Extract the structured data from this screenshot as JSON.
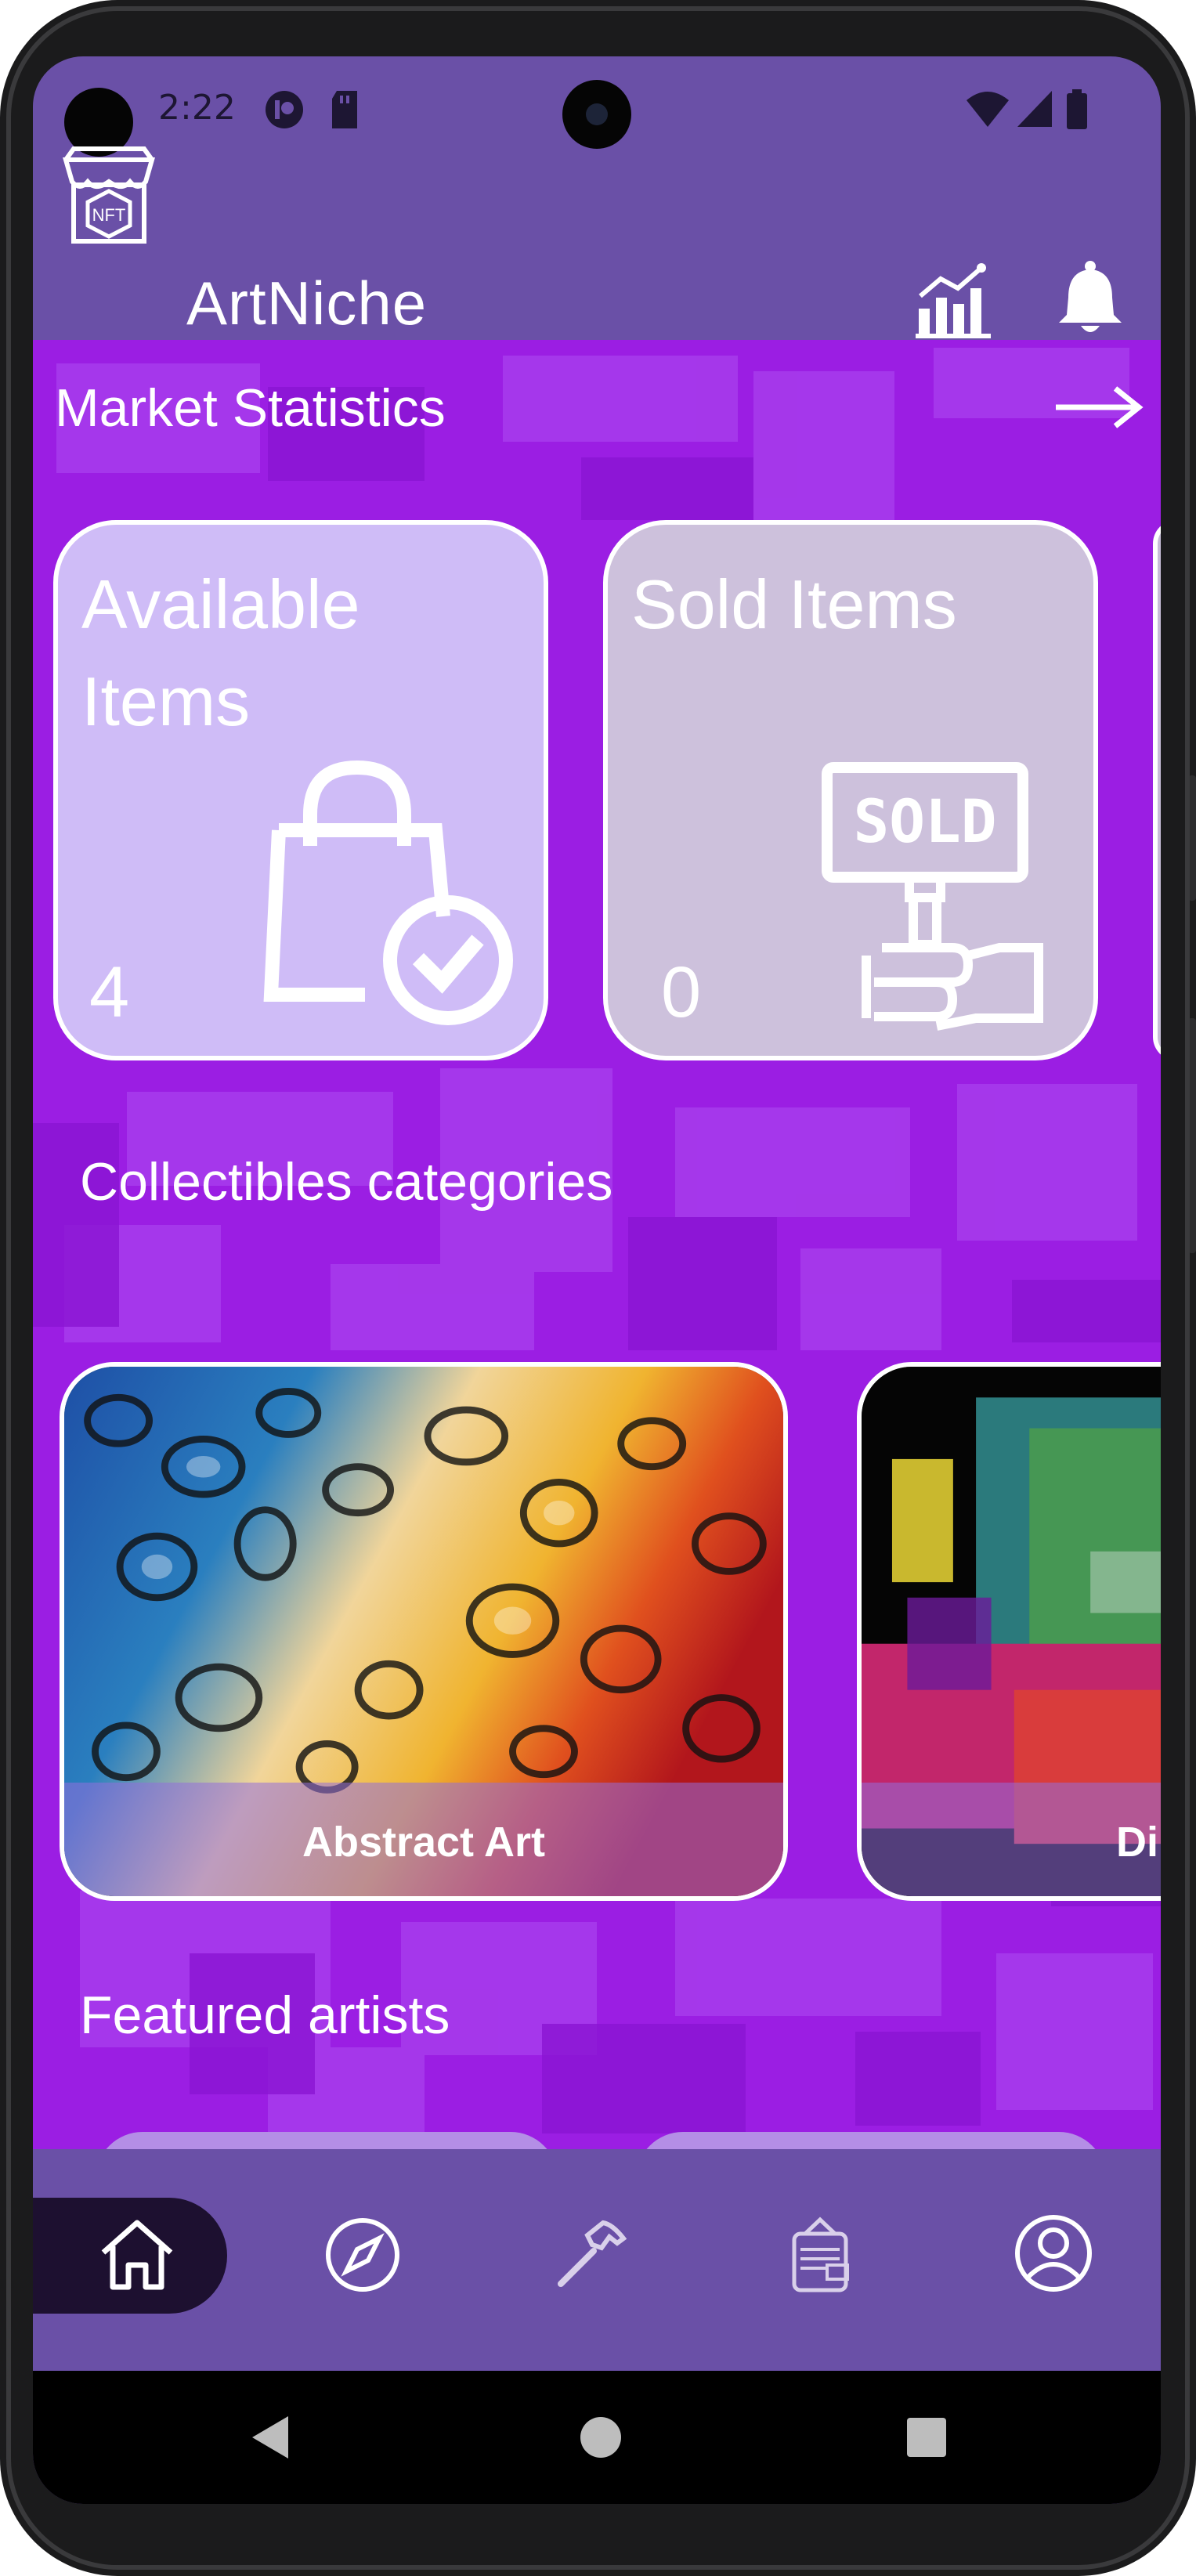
{
  "status_bar": {
    "time": "2:22"
  },
  "app": {
    "title": "ArtNiche",
    "logo_text": "NFT"
  },
  "market": {
    "section_title": "Market Statistics",
    "cards": [
      {
        "label": "Available Items",
        "count": "4"
      },
      {
        "label": "Sold Items",
        "count": "0",
        "sign_text": "SOLD"
      }
    ]
  },
  "categories": {
    "section_title": "Collectibles categories",
    "items": [
      {
        "label": "Abstract Art"
      },
      {
        "label": "Di"
      }
    ]
  },
  "artists": {
    "section_title": "Featured artists"
  },
  "bottom_nav": {
    "items": [
      {
        "icon": "home-icon",
        "active": true
      },
      {
        "icon": "compass-icon",
        "active": false
      },
      {
        "icon": "hammer-icon",
        "active": false
      },
      {
        "icon": "nft-wallet-icon",
        "active": false
      },
      {
        "icon": "profile-icon",
        "active": false
      }
    ]
  },
  "colors": {
    "app_bar": "#6a50a7",
    "content_background": "#9b1ee3",
    "available_card": "#cfbcf7",
    "sold_card": "#cdc1dc",
    "active_nav": "#1d1030"
  }
}
